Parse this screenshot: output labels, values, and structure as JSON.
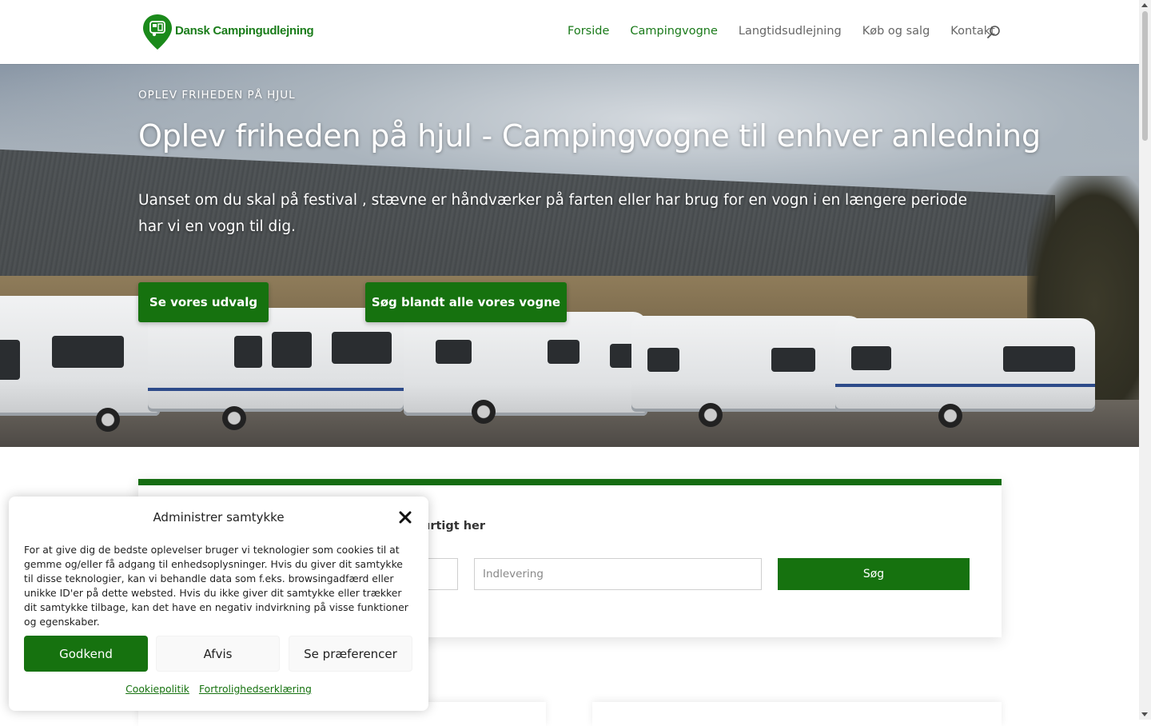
{
  "brand": {
    "name": "Dansk Campingudlejning",
    "color": "#1b7d1b"
  },
  "nav": {
    "items": [
      {
        "label": "Forside",
        "active": true
      },
      {
        "label": "Campingvogne",
        "active": true
      },
      {
        "label": "Langtidsudlejning",
        "active": false
      },
      {
        "label": "Køb og salg",
        "active": false
      },
      {
        "label": "Kontakt",
        "active": false
      }
    ],
    "search_icon": "search-icon"
  },
  "hero": {
    "eyebrow": "OPLEV FRIHEDEN PÅ HJUL",
    "title": "Oplev friheden på hjul - Campingvogne til enhver anledning",
    "text": "Uanset om du skal på festival , stævne er håndværker på farten eller har brug for en vogn i en længere periode har vi en vogn til dig.",
    "buttons": [
      "Se vores udvalg",
      "Søg blandt alle vores vogne"
    ]
  },
  "booking": {
    "title": "urtigt her",
    "dropoff_placeholder": "Indlevering",
    "search_label": "Søg",
    "accent": "#166d12"
  },
  "consent": {
    "title": "Administrer samtykke",
    "text": "For at give dig de bedste oplevelser bruger vi teknologier som cookies til at gemme og/eller få adgang til enhedsoplysninger. Hvis du giver dit samtykke til disse teknologier, kan vi behandle data som f.eks. browsingadfærd eller unikke ID'er på dette websted. Hvis du ikke giver dit samtykke eller trækker dit samtykke tilbage, kan det have en negativ indvirkning på visse funktioner og egenskaber.",
    "accept_label": "Godkend",
    "deny_label": "Afvis",
    "prefs_label": "Se præferencer",
    "links": [
      "Cookiepolitik",
      "Fortrolighedserklæring"
    ]
  }
}
